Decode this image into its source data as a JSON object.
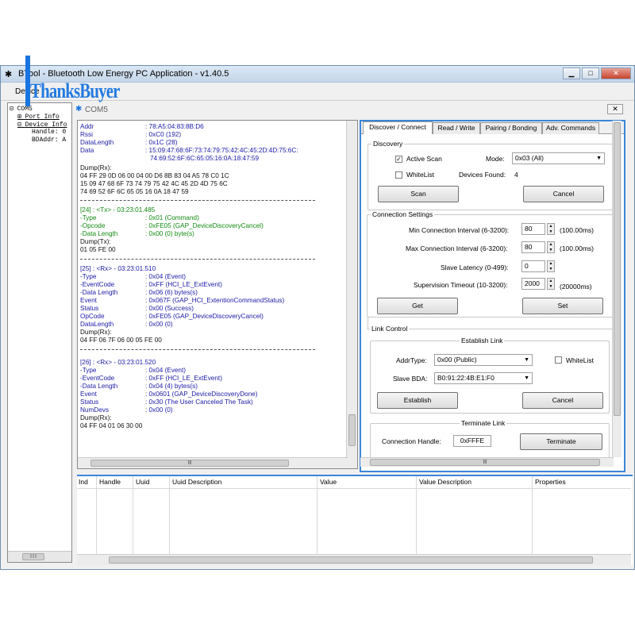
{
  "window": {
    "title": "BTool - Bluetooth Low Energy PC Application - v1.40.5",
    "title_visible": "BTool - Bluetooth Low Energy PC Application - v1.40.5"
  },
  "watermark": "ThanksBuyer",
  "menu": {
    "device": "Device"
  },
  "tree": {
    "root": "COM5",
    "port_info": "Port Info",
    "device_info": "Device Info",
    "handle": "Handle: 0",
    "bdaddr": "BDAddr: A"
  },
  "device_tab": {
    "label": "COM5",
    "close": "✕"
  },
  "log": {
    "first": {
      "addr_k": "Addr",
      "addr_v": ": 78:A5:04:83:8B:D6",
      "rssi_k": "Rssi",
      "rssi_v": ": 0xC0 (192)",
      "dl_k": "DataLength",
      "dl_v": ": 0x1C (28)",
      "data_k": "Data",
      "data_v1": ": 15:09:47:68:6F:73:74:79:75:42:4C:45:2D:4D:75:6C:",
      "data_v2": "74:69:52:6F:6C:65:05:16:0A:18:47:59",
      "dump_k": "Dump(Rx):",
      "dump1": "04 FF 29 0D 06 00 04 00 D6 8B 83 04 A5 78 C0 1C",
      "dump2": "15 09 47 68 6F 73 74 79 75 42 4C 45 2D 4D 75 6C",
      "dump3": "74 69 52 6F 6C 65 05 16 0A 18 47 59"
    },
    "tx24": {
      "head": "[24] : <Tx> - 03:23:01.485",
      "type_k": "-Type",
      "type_v": ": 0x01 (Command)",
      "op_k": "-Opcode",
      "op_v": ": 0xFE05 (GAP_DeviceDiscoveryCancel)",
      "dl_k": "-Data Length",
      "dl_v": ": 0x00 (0) byte(s)",
      "dump_k": "Dump(Tx):",
      "dump1": "01 05 FE 00"
    },
    "rx25": {
      "head": "[25] : <Rx> - 03:23:01.510",
      "type_k": "-Type",
      "type_v": ": 0x04 (Event)",
      "ec_k": "-EventCode",
      "ec_v": ": 0xFF (HCI_LE_ExtEvent)",
      "dl_k": "-Data Length",
      "dl_v": ": 0x06 (6) bytes(s)",
      "ev_k": " Event",
      "ev_v": ": 0x067F (GAP_HCI_ExtentionCommandStatus)",
      "st_k": " Status",
      "st_v": ": 0x00 (Success)",
      "op_k": " OpCode",
      "op_v": ": 0xFE05 (GAP_DeviceDiscoveryCancel)",
      "dl2_k": " DataLength",
      "dl2_v": ": 0x00 (0)",
      "dump_k": "Dump(Rx):",
      "dump1": "04 FF 06 7F 06 00 05 FE 00"
    },
    "rx26": {
      "head": "[26] : <Rx> - 03:23:01.520",
      "type_k": "-Type",
      "type_v": ": 0x04 (Event)",
      "ec_k": "-EventCode",
      "ec_v": ": 0xFF (HCI_LE_ExtEvent)",
      "dl_k": "-Data Length",
      "dl_v": ": 0x04 (4) bytes(s)",
      "ev_k": " Event",
      "ev_v": ": 0x0601 (GAP_DeviceDiscoveryDone)",
      "st_k": " Status",
      "st_v": ": 0x30 (The User Canceled The Task)",
      "nd_k": " NumDevs",
      "nd_v": ": 0x00 (0)",
      "dump_k": "Dump(Rx):",
      "dump1": "04 FF 04 01 06 30 00"
    }
  },
  "tabs": [
    "Discover / Connect",
    "Read / Write",
    "Pairing / Bonding",
    "Adv. Commands"
  ],
  "discovery": {
    "title": "Discovery",
    "active_scan": "Active Scan",
    "active_scan_checked": true,
    "whitelist": "WhiteList",
    "whitelist_checked": false,
    "mode_label": "Mode:",
    "mode_value": "0x03 (All)",
    "devices_found_label": "Devices Found:",
    "devices_found": "4",
    "scan": "Scan",
    "cancel": "Cancel"
  },
  "conn": {
    "title": "Connection Settings",
    "min_label": "Min Connection Interval (6-3200):",
    "min_value": "80",
    "min_unit": "(100.00ms)",
    "max_label": "Max Connection Interval (6-3200):",
    "max_value": "80",
    "max_unit": "(100.00ms)",
    "lat_label": "Slave Latency (0-499):",
    "lat_value": "0",
    "sup_label": "Supervision Timeout (10-3200):",
    "sup_value": "2000",
    "sup_unit": "(20000ms)",
    "get": "Get",
    "set": "Set"
  },
  "link": {
    "title": "Link Control",
    "establish_title": "Establish Link",
    "addrtype_label": "AddrType:",
    "addrtype_value": "0x00 (Public)",
    "whitelist": "WhiteList",
    "slave_label": "Slave BDA:",
    "slave_value": "B0:91:22:4B:E1:F0",
    "establish": "Establish",
    "cancel": "Cancel",
    "terminate_title": "Terminate Link",
    "handle_label": "Connection Handle:",
    "handle_value": "0xFFFE",
    "terminate": "Terminate"
  },
  "table": {
    "headers": [
      "Ind",
      "Handle",
      "Uuid",
      "Uuid Description",
      "Value",
      "Value Description",
      "Properties"
    ]
  },
  "scroll_glyph": "|||"
}
